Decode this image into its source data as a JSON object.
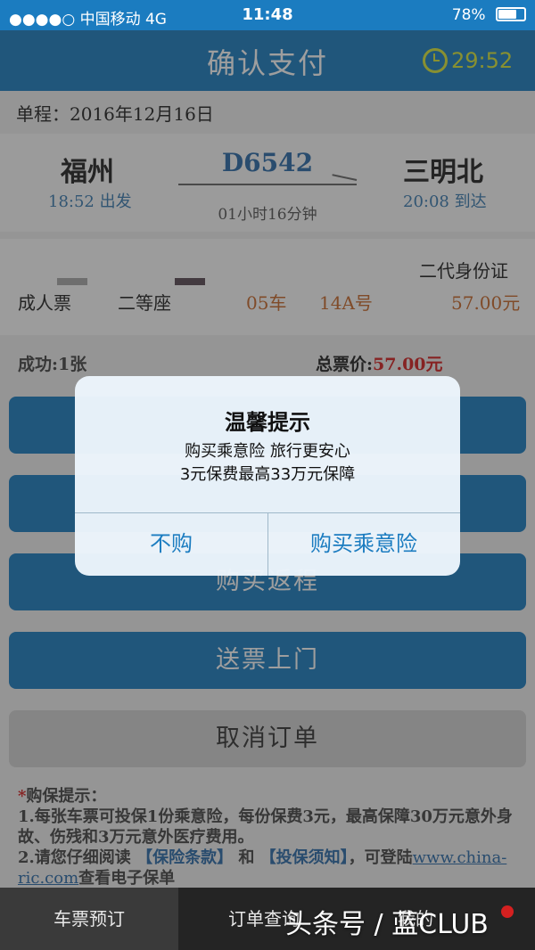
{
  "status_bar": {
    "carrier": "●●●●○ 中国移动  4G",
    "time": "11:48",
    "battery": "78%",
    "battery_level": 0.78
  },
  "header": {
    "title": "确认支付",
    "countdown": "29:52"
  },
  "trip": {
    "single_label": "单程：2016年12月16日",
    "from_city": "福州",
    "from_time": "18:52 出发",
    "to_city": "三明北",
    "to_time": "20:08 到达",
    "train_no": "D6542",
    "duration": "01小时16分钟"
  },
  "passenger": {
    "id_type": "二代身份证",
    "ticket_type": "成人票",
    "seat_class": "二等座",
    "car": "05车",
    "seat": "14A号",
    "price": "57.00元"
  },
  "summary": {
    "success": "成功:1张",
    "total_label": "总票价:",
    "total_value": "57.00元"
  },
  "buttons": {
    "return_trip": "购买返程",
    "delivery": "送票上门",
    "cancel_order": "取消订单"
  },
  "tips": {
    "title": "购保提示：",
    "line1": "1.每张车票可投保1份乘意险，每份保费3元，最高保障30万元意外身故、伤残和3万元意外医疗费用。",
    "line2_a": "2.请您仔细阅读",
    "link1": "【保险条款】",
    "and": "和",
    "link2": "【投保须知】",
    "line2_b": "，可登陆",
    "url": "www.china-ric.com",
    "line2_c": "查看电子保单"
  },
  "dialog": {
    "title": "温馨提示",
    "line1": "购买乘意险 旅行更安心",
    "line2": "3元保费最高33万元保障",
    "decline": "不购",
    "accept": "购买乘意险"
  },
  "tabs": {
    "booking": "车票预订",
    "order_query": "订单查询",
    "mine": "我的"
  },
  "watermark": "头条号 / 蓝CLUB"
}
